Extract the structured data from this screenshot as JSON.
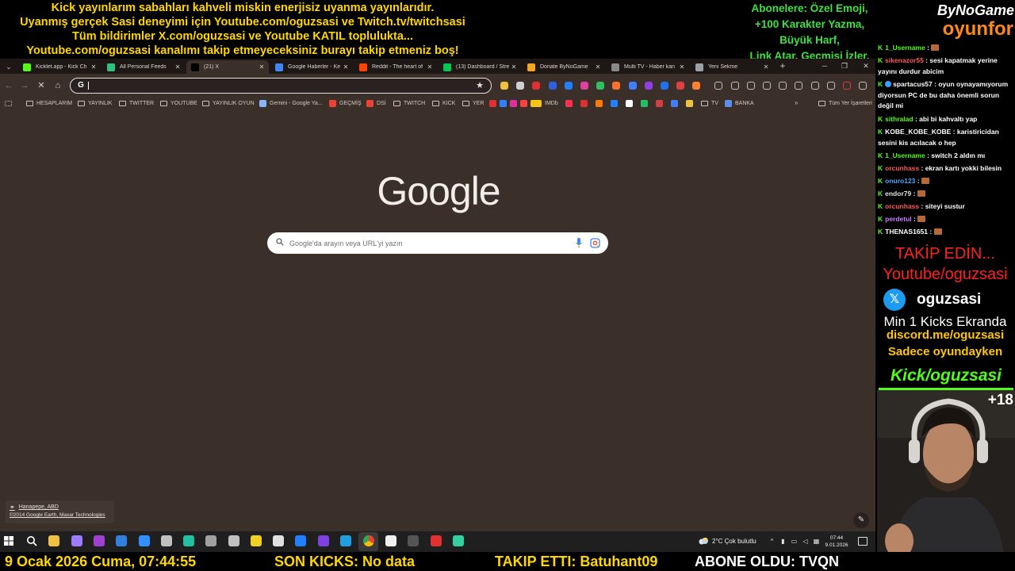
{
  "stream": {
    "banner_lines": [
      "Kick yayınlarım sabahları kahveli miskin enerjisiz uyanma yayınlarıdır.",
      "Uyanmış gerçek Sasi deneyimi için Youtube.com/oguzsasi ve Twitch.tv/twitchsasi",
      "Tüm bildirimler X.com/oguzsasi ve Youtube KATIL toplulukta...",
      "Youtube.com/oguzsasi kanalımı takip etmeyeceksiniz burayı takip etmeniz boş!"
    ],
    "subscriber_lines": [
      "Abonelere: Özel Emoji,",
      "+100 Karakter Yazma,",
      "Büyük Harf,",
      "Link Atar, Geçmişi İzler."
    ],
    "brand_top": "ByNoGame",
    "brand_bottom": "oyunfor",
    "ticker": {
      "date": "9 Ocak 2026 Cuma, 07:44:55",
      "kicks": "SON KICKS: No data",
      "follow": "TAKIP ETTI: Batuhant09",
      "sub": "ABONE OLDU: TVQN"
    },
    "sidebar": {
      "follow_line1": "TAKİP EDİN...",
      "follow_line2": "Youtube/oguzsasi",
      "x_handle": "oguzsasi",
      "min_kicks": "Min 1 Kicks Ekranda",
      "discord": "discord.me/oguzsasi",
      "game_only": "Sadece oyundayken",
      "kick_handle": "Kick/oguzsasi",
      "cam_badge": "+18"
    },
    "chat": [
      {
        "user": "1_Username",
        "color": "#53fc18",
        "sep": " :",
        "text": "",
        "emote": true
      },
      {
        "user": "sikenazor55",
        "color": "#ff5a5a",
        "sep": " :",
        "text": " sesi kapatmak yerine yayını durdur abicim",
        "emote": false
      },
      {
        "user": "spartacus57",
        "color": "#ffffff",
        "sep": " :",
        "text": " oyun oynayamıyorum diyorsun PC de bu daha önemli sorun değil mi",
        "emote": false,
        "bot": true
      },
      {
        "user": "sithralad",
        "color": "#53fc18",
        "sep": " :",
        "text": " abi bi kahvaltı yap",
        "emote": false
      },
      {
        "user": "KOBE_KOBE_KOBE",
        "color": "#ffffff",
        "sep": " :",
        "text": " karistiricidan sesini kis acılacak o hep",
        "emote": false
      },
      {
        "user": "1_Username",
        "color": "#53fc18",
        "sep": " :",
        "text": " switch 2 aldın mı",
        "emote": false
      },
      {
        "user": "orcunhass",
        "color": "#ff5a5a",
        "sep": " :",
        "text": " ekran kartı yokki bilesin",
        "emote": false
      },
      {
        "user": "onuro123",
        "color": "#4aa8ff",
        "sep": " :",
        "text": "",
        "emote": true
      },
      {
        "user": "endor79",
        "color": "#e0e0e0",
        "sep": " :",
        "text": "",
        "emote": true
      },
      {
        "user": "orcunhass",
        "color": "#ff5a5a",
        "sep": " :",
        "text": " siteyi sustur",
        "emote": false
      },
      {
        "user": "perdetul",
        "color": "#c77dff",
        "sep": " :",
        "text": "",
        "emote": true
      },
      {
        "user": "THENAS1651",
        "color": "#ffffff",
        "sep": " :",
        "text": "",
        "emote": true
      }
    ]
  },
  "browser": {
    "tabs": [
      {
        "title": "Kicklet.app - Kick Ch",
        "favicon": "kicklet-icon",
        "color": "#53fc18",
        "active": false
      },
      {
        "title": "All Personal Feeds",
        "favicon": "feeds-icon",
        "color": "#2ec27e",
        "active": false
      },
      {
        "title": "(21) X",
        "favicon": "x-icon",
        "color": "#000000",
        "active": true
      },
      {
        "title": "Google Haberler - Ke",
        "favicon": "google-news-icon",
        "color": "#4285f4",
        "active": false
      },
      {
        "title": "Reddit - The heart of",
        "favicon": "reddit-icon",
        "color": "#ff4500",
        "active": false
      },
      {
        "title": "(13) Dashboard / Stre",
        "favicon": "dashboard-icon",
        "color": "#00c853",
        "active": false
      },
      {
        "title": "Donate ByNoGame",
        "favicon": "bynogame-icon",
        "color": "#f5a623",
        "active": false
      },
      {
        "title": "Multi TV - Haber kan",
        "favicon": "multitv-icon",
        "color": "#888888",
        "active": false
      },
      {
        "title": "Yeni Sekme",
        "favicon": "chrome-icon",
        "color": "#9aa0a6",
        "active": false
      }
    ],
    "bookmarks": [
      {
        "label": "HESAPLARIM",
        "folder": true
      },
      {
        "label": "YAYINLIK",
        "folder": true
      },
      {
        "label": "TWITTER",
        "folder": true
      },
      {
        "label": "YOUTUBE",
        "folder": true
      },
      {
        "label": "YAYINLIK OYUN",
        "folder": true
      },
      {
        "label": "Gemini - Google Ya...",
        "folder": false,
        "color": "#8ab4f8"
      },
      {
        "label": "GEÇMİŞ",
        "folder": false,
        "color": "#ea4335"
      },
      {
        "label": "DSİ",
        "folder": false,
        "color": "#ea4335"
      },
      {
        "label": "TWITCH",
        "folder": true
      },
      {
        "label": "KICK",
        "folder": true
      },
      {
        "label": "YER",
        "folder": true
      },
      {
        "label": "IMDb",
        "folder": false,
        "color": "#f5c518"
      },
      {
        "label": "TV",
        "folder": true
      },
      {
        "label": "BANKA",
        "folder": false,
        "color": "#5b8def"
      }
    ],
    "bookmarks_more": "Tüm Yer İşaretleri",
    "search_placeholder": "Google'da arayın veya URL'yi yazın",
    "logo": "Google",
    "attribution_place": "Hanapepe, ABD",
    "attribution_copy": "©2014 Google Earth, Maxar Technologies"
  },
  "taskbar": {
    "weather_text": "2°C  Çok bulutlu",
    "time": "07:44",
    "date": "9.01.2026"
  },
  "colors": {
    "banner_yellow": "#ffd700",
    "banner_green": "#3fe03f",
    "kick_green": "#53fc18",
    "browser_bg": "#3b2f29"
  }
}
